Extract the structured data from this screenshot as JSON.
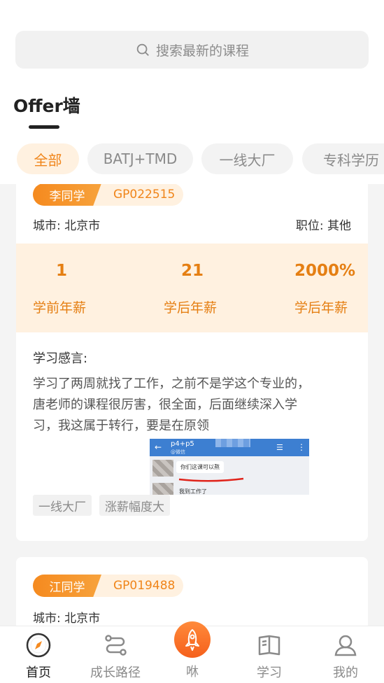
{
  "search": {
    "placeholder": "搜索最新的课程",
    "icon": "search-icon"
  },
  "page_title": "Offer墙",
  "filters": [
    {
      "label": "全部",
      "active": true
    },
    {
      "label": "BATJ+TMD",
      "active": false
    },
    {
      "label": "一线大厂",
      "active": false
    },
    {
      "label": "专科学历",
      "active": false
    }
  ],
  "cards": [
    {
      "name": "李同学",
      "code": "GP022515",
      "city": "城市: 北京市",
      "position": "职位: 其他",
      "stats": [
        {
          "value": "1",
          "label": "学前年薪"
        },
        {
          "value": "21",
          "label": "学后年薪"
        },
        {
          "value": "2000%",
          "label": "学后年薪"
        }
      ],
      "feel_title": "学习感言:",
      "feel_body": "学习了两周就找了工作，之前不是学这个专业的，唐老师的课程很厉害，很全面，后面继续深入学习，我这属于转行，要是在原领",
      "screenshot": {
        "title": "p4+p5",
        "subtitle": "@微信",
        "message1": "你们这课可以熬",
        "message2": "我到工作了"
      },
      "tags": [
        "一线大厂",
        "涨薪幅度大"
      ]
    },
    {
      "name": "江同学",
      "code": "GP019488",
      "city": "城市: 北京市"
    }
  ],
  "tabbar": [
    {
      "label": "首页",
      "icon": "compass-icon",
      "active": true
    },
    {
      "label": "成长路径",
      "icon": "path-icon",
      "active": false
    },
    {
      "label": "咻",
      "icon": "rocket-icon",
      "active": false
    },
    {
      "label": "学习",
      "icon": "book-icon",
      "active": false
    },
    {
      "label": "我的",
      "icon": "user-icon",
      "active": false
    }
  ],
  "colors": {
    "accent": "#f0851a",
    "accent_light": "#fff1e0",
    "background": "#f4f4f4"
  }
}
